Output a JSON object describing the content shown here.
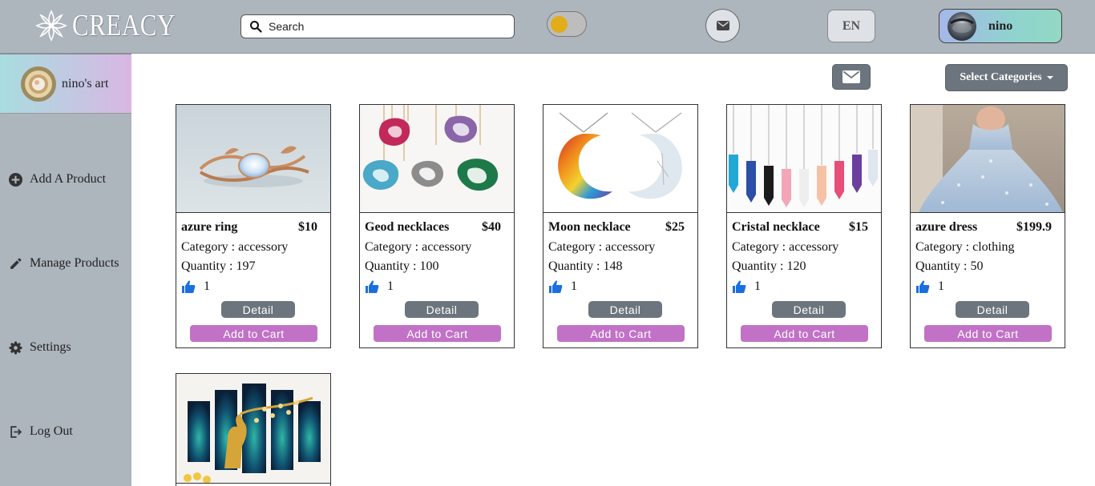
{
  "header": {
    "logo_text": "CREACY",
    "search_placeholder": "Search",
    "lang": "EN",
    "user_name": "nino"
  },
  "sidebar": {
    "shop_name": "nino's art",
    "items": [
      {
        "label": "Add A Product",
        "icon": "plus-circle-icon"
      },
      {
        "label": "Manage Products",
        "icon": "pencil-icon"
      },
      {
        "label": "Settings",
        "icon": "gear-icon"
      },
      {
        "label": "Log Out",
        "icon": "logout-icon"
      }
    ]
  },
  "toolbar": {
    "categories_label": "Select Categories"
  },
  "labels": {
    "category_prefix": "Category : ",
    "quantity_prefix": "Quantity : ",
    "detail": "Detail",
    "add_to_cart": "Add to Cart"
  },
  "products": [
    {
      "title": "azure ring",
      "price": "$10",
      "category": "Category : accessory",
      "quantity": "Quantity : 197",
      "likes": "1"
    },
    {
      "title": "Geod necklaces",
      "price": "$40",
      "category": "Category : accessory",
      "quantity": "Quantity : 100",
      "likes": "1"
    },
    {
      "title": "Moon necklace",
      "price": "$25",
      "category": "Category : accessory",
      "quantity": "Quantity : 148",
      "likes": "1"
    },
    {
      "title": "Cristal necklace",
      "price": "$15",
      "category": "Category : accessory",
      "quantity": "Quantity : 120",
      "likes": "1"
    },
    {
      "title": "azure dress",
      "price": "$199.9",
      "category": "Category : clothing",
      "quantity": "Quantity : 50",
      "likes": "1"
    }
  ],
  "colors": {
    "header_bg": "#adb5bd",
    "button_gray": "#6c757d",
    "cart_purple": "#c172c6",
    "like_blue": "#1a6fe0",
    "toggle_knob": "#e2ad18"
  }
}
